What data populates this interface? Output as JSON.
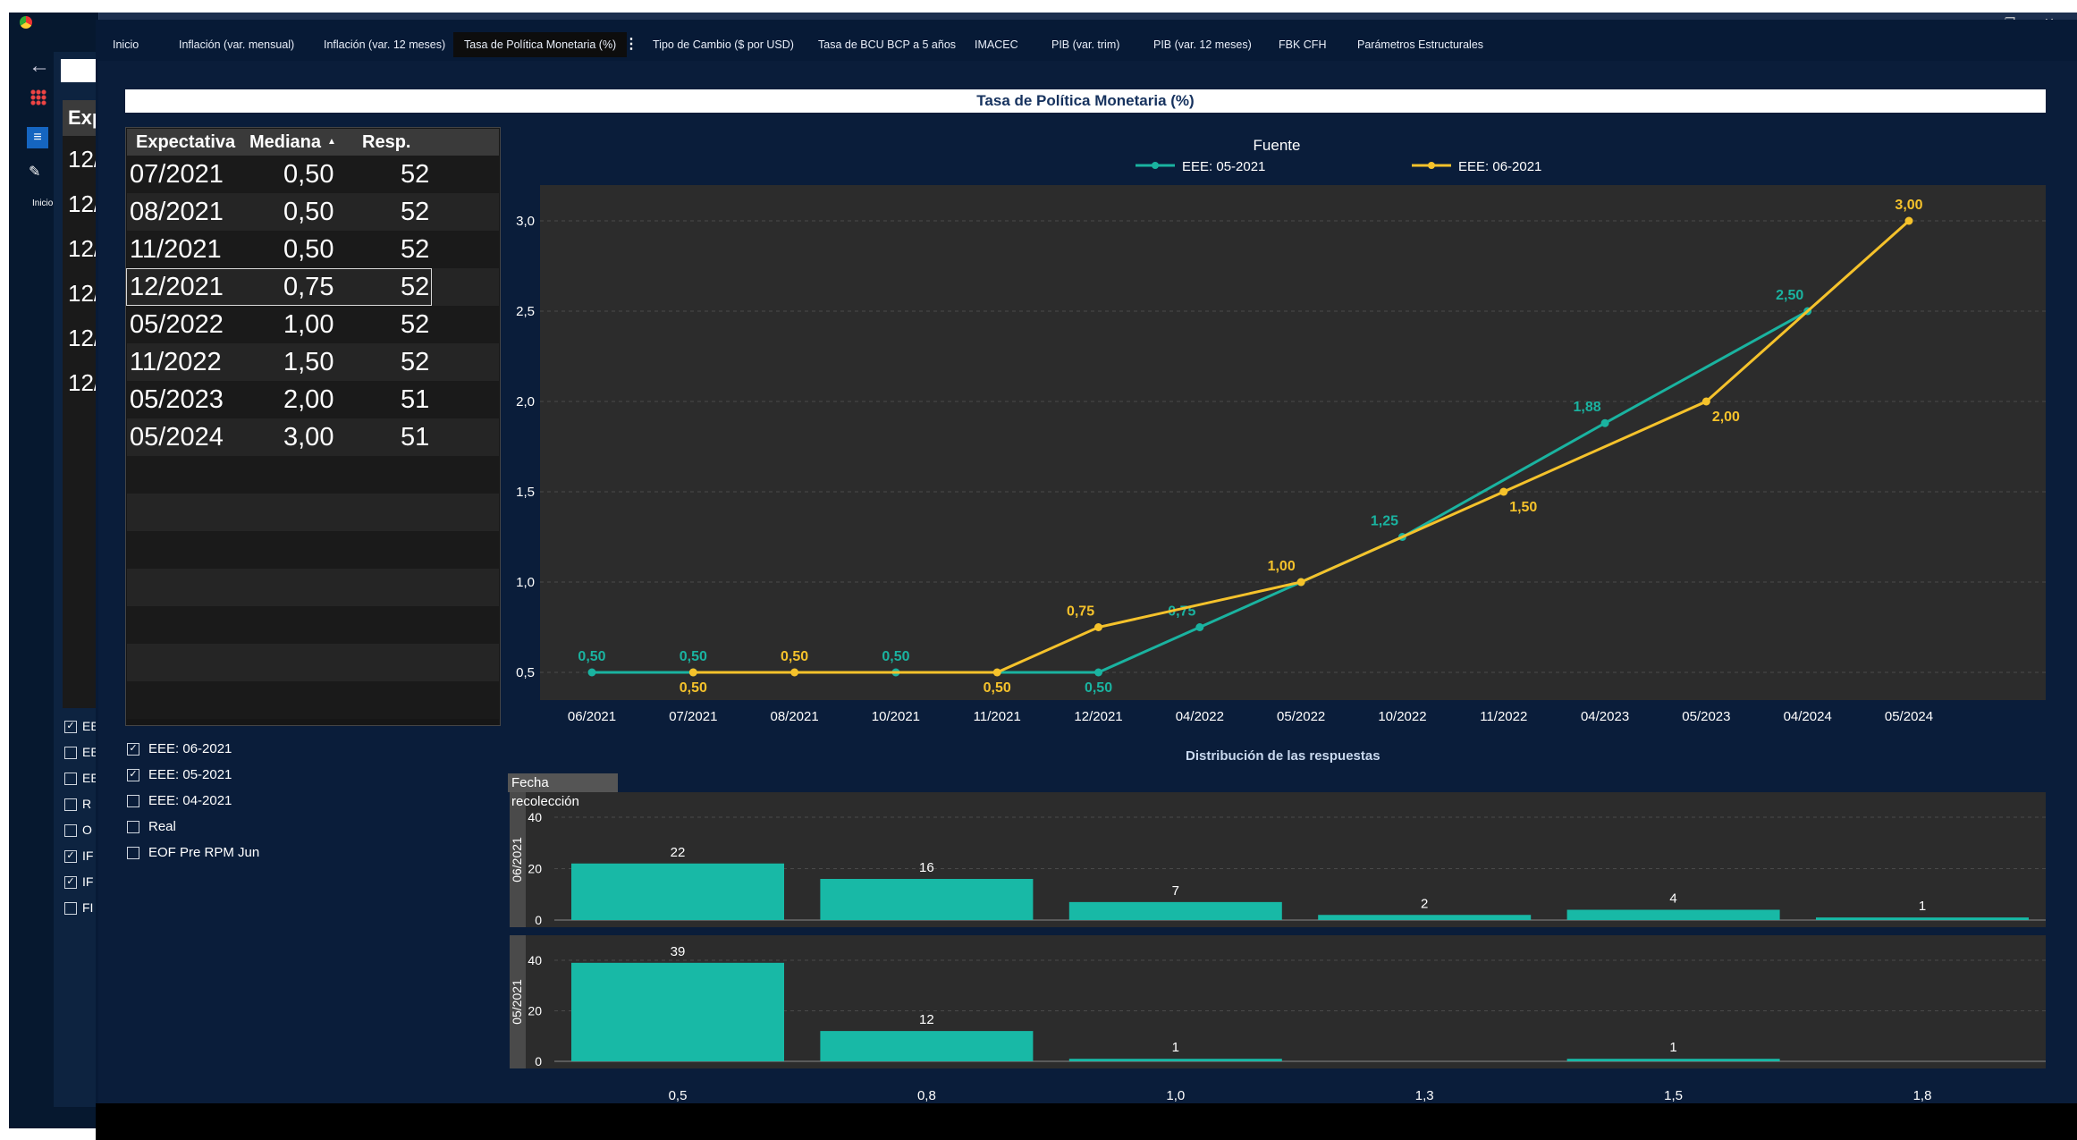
{
  "browser": {
    "ghost_tab_label": "Inicio",
    "ghost_expect_header": "Exp",
    "ghost_rows": [
      "12/",
      "12/",
      "12/",
      "12/",
      "12/",
      "12/"
    ],
    "ghost_checks": [
      {
        "label": "EE",
        "checked": true
      },
      {
        "label": "EE",
        "checked": false
      },
      {
        "label": "EE",
        "checked": false
      },
      {
        "label": "R",
        "checked": false
      },
      {
        "label": "O",
        "checked": false
      },
      {
        "label": "IF",
        "checked": true
      },
      {
        "label": "IF",
        "checked": true
      },
      {
        "label": "FI",
        "checked": false
      }
    ]
  },
  "tabs": [
    {
      "label": "Inicio",
      "active": false
    },
    {
      "label": "Inflación (var. mensual)",
      "active": false
    },
    {
      "label": "Inflación (var. 12 meses)",
      "active": false
    },
    {
      "label": "Tasa de Política Monetaria (%)",
      "active": true
    },
    {
      "label": "Tipo de Cambio ($ por USD)",
      "active": false
    },
    {
      "label": "Tasa de BCU BCP a 5 años",
      "active": false
    },
    {
      "label": "IMACEC",
      "active": false
    },
    {
      "label": "PIB (var. trim)",
      "active": false
    },
    {
      "label": "PIB (var. 12 meses)",
      "active": false
    },
    {
      "label": "FBK CFH",
      "active": false
    },
    {
      "label": "Parámetros Estructurales",
      "active": false
    }
  ],
  "tab_more_icon": "vertical-ellipsis-icon",
  "page_title": "Tasa de Política Monetaria (%)",
  "table": {
    "headers": [
      "Expectativa",
      "Mediana",
      "Resp."
    ],
    "sort_indicator": "▲",
    "rows": [
      [
        "07/2021",
        "0,50",
        "52"
      ],
      [
        "08/2021",
        "0,50",
        "52"
      ],
      [
        "11/2021",
        "0,50",
        "52"
      ],
      [
        "12/2021",
        "0,75",
        "52"
      ],
      [
        "05/2022",
        "1,00",
        "52"
      ],
      [
        "11/2022",
        "1,50",
        "52"
      ],
      [
        "05/2023",
        "2,00",
        "51"
      ],
      [
        "05/2024",
        "3,00",
        "51"
      ]
    ],
    "selected_row": 3
  },
  "filters": [
    {
      "label": "EEE: 06-2021",
      "checked": true
    },
    {
      "label": "EEE: 05-2021",
      "checked": true
    },
    {
      "label": "EEE: 04-2021",
      "checked": false
    },
    {
      "label": "Real",
      "checked": false
    },
    {
      "label": "EOF Pre RPM Jun",
      "checked": false
    }
  ],
  "dist_title": "Distribución de las respuestas",
  "fecha_tag": "Fecha recolección",
  "colors": {
    "teal": "#1ab3a0",
    "yellow": "#f5c22b",
    "bg": "#0a1d3a",
    "plot": "#2c2c2c"
  },
  "chart_data": [
    {
      "type": "line",
      "legend_title": "Fuente",
      "legend_position": "top-center",
      "categories": [
        "06/2021",
        "07/2021",
        "08/2021",
        "10/2021",
        "11/2021",
        "12/2021",
        "04/2022",
        "05/2022",
        "10/2022",
        "11/2022",
        "04/2023",
        "05/2023",
        "04/2024",
        "05/2024"
      ],
      "ylim": [
        0.5,
        3.0
      ],
      "yticks": [
        "0,5",
        "1,0",
        "1,5",
        "2,0",
        "2,5",
        "3,0"
      ],
      "grid": true,
      "series": [
        {
          "name": "EEE: 05-2021",
          "color": "#1ab3a0",
          "points": [
            [
              0,
              0.5
            ],
            [
              1,
              0.5
            ],
            [
              3,
              0.5
            ],
            [
              5,
              0.5
            ],
            [
              6,
              0.75
            ],
            [
              7,
              1.0
            ],
            [
              8,
              1.25
            ],
            [
              10,
              1.88
            ],
            [
              12,
              2.5
            ]
          ],
          "labels": [
            "0,50",
            "0,50",
            "0,50",
            "0,50",
            "0,75",
            "",
            "1,25",
            "1,88",
            "2,50"
          ]
        },
        {
          "name": "EEE: 06-2021",
          "color": "#f5c22b",
          "points": [
            [
              1,
              0.5
            ],
            [
              2,
              0.5
            ],
            [
              4,
              0.5
            ],
            [
              5,
              0.75
            ],
            [
              7,
              1.0
            ],
            [
              9,
              1.5
            ],
            [
              11,
              2.0
            ],
            [
              13,
              3.0
            ]
          ],
          "labels": [
            "0,50",
            "0,50",
            "0,50",
            "0,75",
            "1,00",
            "1,50",
            "2,00",
            "3,00"
          ]
        }
      ]
    },
    {
      "type": "bar",
      "title": "Distribución de las respuestas",
      "categories": [
        "0,5",
        "0,8",
        "1,0",
        "1,3",
        "1,5",
        "1,8"
      ],
      "ylim": [
        0,
        40
      ],
      "yticks": [
        "0",
        "20",
        "40"
      ],
      "series": [
        {
          "name": "06/2021",
          "values": [
            22,
            16,
            7,
            2,
            4,
            1
          ]
        },
        {
          "name": "05/2021",
          "values": [
            39,
            12,
            1,
            0,
            1,
            0
          ]
        }
      ]
    }
  ]
}
